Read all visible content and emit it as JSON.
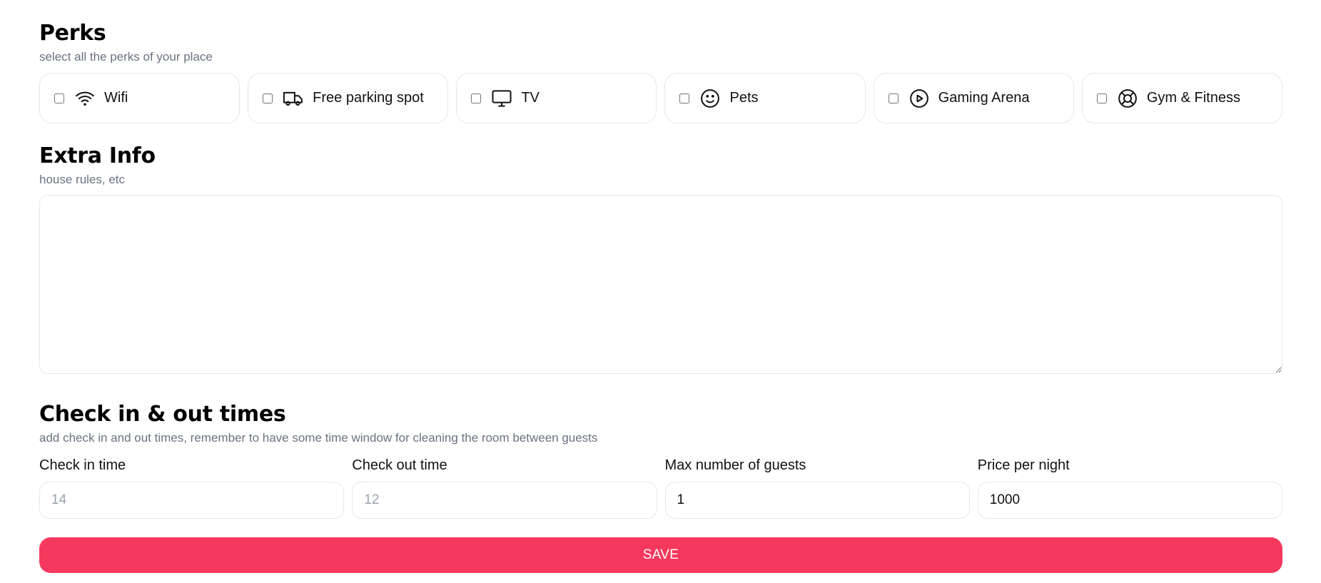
{
  "perks": {
    "title": "Perks",
    "subtitle": "select all the perks of your place",
    "items": [
      {
        "label": "Wifi",
        "icon": "wifi-icon",
        "checked": false
      },
      {
        "label": "Free parking spot",
        "icon": "truck-icon",
        "checked": false
      },
      {
        "label": "TV",
        "icon": "monitor-icon",
        "checked": false
      },
      {
        "label": "Pets",
        "icon": "smiley-icon",
        "checked": false
      },
      {
        "label": "Gaming Arena",
        "icon": "play-circle-icon",
        "checked": false
      },
      {
        "label": "Gym & Fitness",
        "icon": "lifebuoy-icon",
        "checked": false
      }
    ]
  },
  "extra": {
    "title": "Extra Info",
    "subtitle": "house rules, etc",
    "value": ""
  },
  "checkin": {
    "title": "Check in & out times",
    "subtitle": "add check in and out times, remember to have some time window for cleaning the room between guests",
    "fields": [
      {
        "label": "Check in time",
        "value": "",
        "placeholder": "14"
      },
      {
        "label": "Check out time",
        "value": "",
        "placeholder": "12"
      },
      {
        "label": "Max number of guests",
        "value": "1",
        "placeholder": ""
      },
      {
        "label": "Price per night",
        "value": "1000",
        "placeholder": ""
      }
    ]
  },
  "save": {
    "label": "SAVE"
  },
  "colors": {
    "accent": "#f5385d",
    "border": "#e5e7eb",
    "muted": "#6b7280"
  }
}
